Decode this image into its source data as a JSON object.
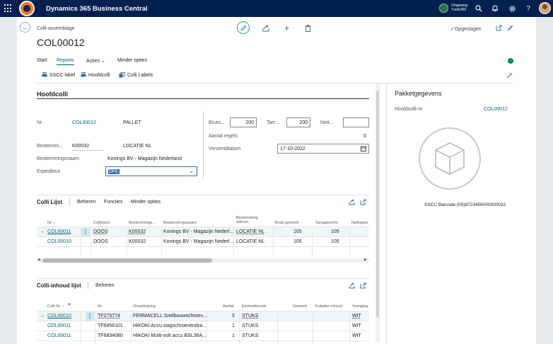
{
  "app": {
    "title": "Dynamics 365 Business Central",
    "environment_label": "Omgeving:",
    "environment_name": "Trade365"
  },
  "header": {
    "breadcrumb": "Colli-assemblage",
    "page_title": "COL00012",
    "saved_status": "Opgeslagen"
  },
  "actions": {
    "start": "Start",
    "reports": "Reports",
    "acties": "Acties",
    "minder_opties": "Minder opties",
    "sscc_label": "SSCC label",
    "hoofdcolli": "Hoofdcolli",
    "colli_labels": "Colli Labels"
  },
  "general": {
    "section_title": "Hoofdcolli",
    "nr_label": "Nr.",
    "nr_value": "COL00012",
    "nr_desc": "PALLET",
    "bestemming_label": "Bestemmi...",
    "bestemming_value": "K00032",
    "bestemming_desc": "LOCATIE NL",
    "bestemmingsnaam_label": "Bestemmingsnaam",
    "bestemmingsnaam_value": "Konings BV - Magazijn Nederland",
    "expediteur_label": "Expediteur",
    "expediteur_value": "DHL",
    "bruto_label": "Bruto...",
    "bruto_value": "200",
    "tarra_label": "Tarr...",
    "tarra_value": "200",
    "netto_label": "Nett...",
    "netto_value": "",
    "aantal_regels_label": "Aantal regels",
    "aantal_regels_value": "0",
    "verzenddatum_label": "Verzenddatum",
    "verzenddatum_value": "17-10-2022"
  },
  "colli_lijst": {
    "title": "Colli Lijst",
    "nav": [
      "Beheren",
      "Functies",
      "Minder opties"
    ],
    "columns": [
      "Nr. ↓",
      "Collisoort",
      "Bestemmings...",
      "Bestemmingsnaam",
      "Bestemming adresn.",
      "Bruto gewicht",
      "Tarragewicht",
      "Nettogew"
    ],
    "rows": [
      {
        "nr": "COL00011",
        "soort": "DOOS",
        "bestemming": "K00032",
        "naam": "Konings BV - Magazijn Nederl...",
        "adres": "LOCATIE NL",
        "bruto": "105",
        "tarra": "105"
      },
      {
        "nr": "COL00010",
        "soort": "DOOS",
        "bestemming": "K00032",
        "naam": "Konings BV - Magazijn Nederl...",
        "adres": "LOCATIE NL",
        "bruto": "105",
        "tarra": "105"
      }
    ]
  },
  "inhoud_lijst": {
    "title": "Colli-inhoud lijst",
    "nav": [
      "Beheren"
    ],
    "columns": [
      "Colli Nr. ↑",
      "Nr.",
      "Omschrijving",
      "Aantal",
      "Eenheidscode",
      "Gewicht",
      "Kubieke inhoud",
      "Vestiging"
    ],
    "rows": [
      {
        "colli": "COL00010",
        "nr": "TF275774",
        "oms": "FERMACELL Snelbouwschroev...",
        "aantal": "5",
        "eenheid": "STUKS",
        "vest": "WIT"
      },
      {
        "colli": "COL00011",
        "nr": "TF6856101",
        "oms": "HIKOKI Accu slagschroevendra...",
        "aantal": "1",
        "eenheid": "STUKS",
        "vest": "WIT"
      },
      {
        "colli": "COL00011",
        "nr": "TF6834080",
        "oms": "HIKOKI Multi-volt accu BSL36A...",
        "aantal": "1",
        "eenheid": "STUKS",
        "vest": "WIT"
      }
    ]
  },
  "factbox": {
    "title": "Pakketgegevens",
    "hoofdcolli_label": "Hoofdcolli-nr.",
    "hoofdcolli_value": "COL00012",
    "sscc_text": "SSCC Barcode (00)8723456000000032"
  },
  "colors": {
    "topbar": "#002050",
    "accent": "#00607a",
    "logo": "#f47920",
    "teal": "#3a9c8f"
  }
}
